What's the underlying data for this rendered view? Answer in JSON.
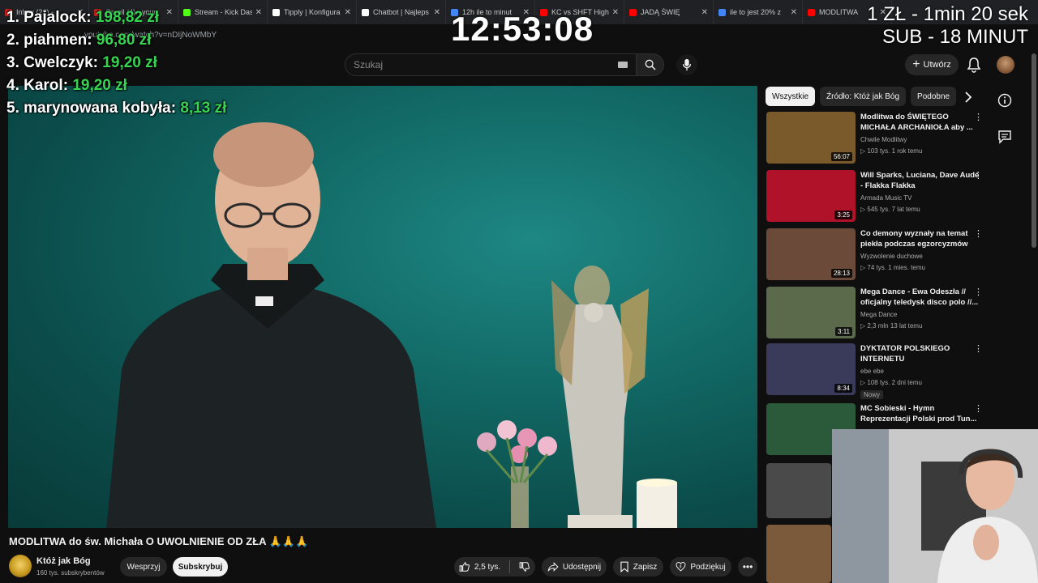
{
  "browser": {
    "tabs": [
      {
        "label": "Inbox (22) - ...",
        "color": "#c5221f"
      },
      {
        "label": "Gmail (4) - your",
        "color": "#c5221f"
      },
      {
        "label": "Stream - Kick Das",
        "color": "#53fc18"
      },
      {
        "label": "Tipply | Konfigura",
        "color": "#ffffff"
      },
      {
        "label": "Chatbot | Najleps",
        "color": "#ffffff"
      },
      {
        "label": "12h ile to minut",
        "color": "#4285f4"
      },
      {
        "label": "KC vs SHFT Highl",
        "color": "#ff0000"
      },
      {
        "label": "JADĄ ŚWIĘ",
        "color": "#ff0000"
      },
      {
        "label": "ile to jest 20% z",
        "color": "#4285f4"
      },
      {
        "label": "MODLITWA",
        "color": "#ff0000"
      }
    ],
    "address": "youtube.com/watch?v=nDIjNoWMbY"
  },
  "overlay": {
    "clock": "12:53:08",
    "timer_line1": "1 ZŁ - 1min 20 sek",
    "timer_line2": "SUB - 18 MINUT",
    "donors": [
      {
        "name": "1. Pajalock:",
        "amount": "198,82 zł"
      },
      {
        "name": "2. piahmen:",
        "amount": "96,80 zł"
      },
      {
        "name": "3. Cwelczyk:",
        "amount": "19,20 zł"
      },
      {
        "name": "4. Karol:",
        "amount": "19,20 zł"
      },
      {
        "name": "5. marynowana kobyła:",
        "amount": "8,13 zł"
      }
    ]
  },
  "header": {
    "search_placeholder": "Szukaj",
    "create_label": "Utwórz"
  },
  "video": {
    "title": "MODLITWA do św. Michała O UWOLNIENIE OD ZŁA 🙏🙏🙏",
    "channel": "Któż jak Bóg",
    "subscribers": "160 tys. subskrybentów",
    "support_label": "Wesprzyj",
    "subscribe_label": "Subskrybuj",
    "likes": "2,5 tys.",
    "share_label": "Udostępnij",
    "save_label": "Zapisz",
    "thanks_label": "Podziękuj"
  },
  "sidebar": {
    "chips": [
      "Wszystkie",
      "Źródło: Któż jak Bóg",
      "Podobne"
    ],
    "recommendations": [
      {
        "title": "Modlitwa do ŚWIĘTEGO MICHAŁA ARCHANIOŁA aby ...",
        "channel": "Chwile Modlitwy",
        "meta": "▷ 103 tys.  1 rok temu",
        "duration": "56:07",
        "thumb": "#7a5a2a"
      },
      {
        "title": "Will Sparks, Luciana, Dave Audé - Flakka Flakka",
        "channel": "Armada Music TV",
        "meta": "▷ 545 tys.  7 lat temu",
        "duration": "3:25",
        "thumb": "#b0122a"
      },
      {
        "title": "Co demony wyznały na temat piekła podczas egzorcyzmów",
        "channel": "Wyzwolenie duchowe",
        "meta": "▷ 74 tys.  1 mies. temu",
        "duration": "28:13",
        "thumb": "#6b4a3a"
      },
      {
        "title": "Mega Dance - Ewa Odeszła // oficjalny teledysk disco polo //...",
        "channel": "Mega Dance",
        "meta": "▷ 2,3 mln  13 lat temu",
        "duration": "3:11",
        "thumb": "#5a6a4a"
      },
      {
        "title": "DYKTATOR POLSKIEGO INTERNETU",
        "channel": "ebe ebe",
        "meta": "▷ 108 tys.  2 dni temu",
        "duration": "8:34",
        "badge": "Nowy",
        "thumb": "#3a3a5a"
      },
      {
        "title": "MC Sobieski - Hymn Reprezentacji Polski prod Tun...",
        "channel": "",
        "meta": "",
        "duration": "",
        "thumb": "#2a5a3a"
      }
    ]
  }
}
